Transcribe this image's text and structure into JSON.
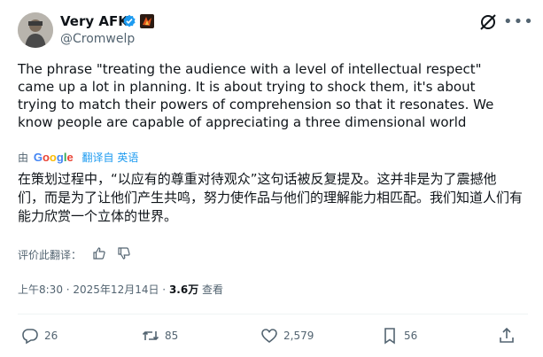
{
  "post": {
    "author_name": "Very AFK",
    "author_handle": "@Cromwelp",
    "text_en": "The phrase \"treating the audience with a level of intellectual respect\" came up a lot in planning. It is about trying to shock them, it's about trying to match their powers of comprehension so that it resonates. We know people are capable of appreciating a three dimensional world",
    "translated_by_prefix": "由",
    "translated_by_brand": "Google",
    "translated_from": "翻译自 英语",
    "text_zh": "在策划过程中，“以应有的尊重对待观众”这句话被反复提及。这并非是为了震撼他们，而是为了让他们产生共鸣，努力使作品与他们的理解能力相匹配。我们知道人们有能力欣赏一个立体的世界。",
    "rate_translation_label": "评价此翻译：",
    "timestamp": "上午8:30 · 2025年12月14日 ·",
    "views_count": "3.6万",
    "views_label": "查看"
  },
  "actions": {
    "replies": "26",
    "reposts": "85",
    "likes": "2,579",
    "bookmarks": "56"
  },
  "colors": {
    "verified": "#1d9bf0",
    "text": "#0f1419",
    "secondary": "#536471",
    "link": "#1d9bf0"
  },
  "icons": [
    "verified-badge-icon",
    "grok-icon",
    "more-icon",
    "reply-icon",
    "repost-icon",
    "like-icon",
    "bookmark-icon",
    "share-icon",
    "thumbs-up-icon",
    "thumbs-down-icon"
  ]
}
